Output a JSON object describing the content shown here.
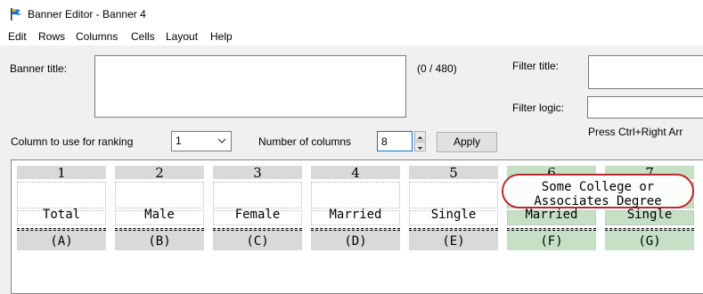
{
  "window": {
    "title": "Banner Editor - Banner 4"
  },
  "menu": [
    "Edit",
    "Rows",
    "Columns",
    "Cells",
    "Layout",
    "Help"
  ],
  "banner_title": {
    "label": "Banner title:",
    "value": "",
    "counter": "(0 / 480)"
  },
  "filter_title": {
    "label": "Filter title:",
    "value": ""
  },
  "filter_logic": {
    "label": "Filter logic:",
    "value": "",
    "hint": "Press Ctrl+Right Arr"
  },
  "ranking": {
    "label": "Column to use for ranking",
    "value": "1"
  },
  "num_columns": {
    "label": "Number of columns",
    "value": "8"
  },
  "apply_label": "Apply",
  "columns": [
    {
      "num": "1",
      "lines": [
        "",
        "",
        "Total"
      ],
      "letter": "(A)",
      "green": false
    },
    {
      "num": "2",
      "lines": [
        "",
        "",
        "Male"
      ],
      "letter": "(B)",
      "green": false
    },
    {
      "num": "3",
      "lines": [
        "",
        "",
        "Female"
      ],
      "letter": "(C)",
      "green": false
    },
    {
      "num": "4",
      "lines": [
        "",
        "",
        "Married"
      ],
      "letter": "(D)",
      "green": false
    },
    {
      "num": "5",
      "lines": [
        "",
        "",
        "Single"
      ],
      "letter": "(E)",
      "green": false
    },
    {
      "num": "6",
      "lines": [
        "",
        "",
        "Married"
      ],
      "letter": "(F)",
      "green": true
    },
    {
      "num": "7",
      "lines": [
        "",
        "",
        "Single"
      ],
      "letter": "(G)",
      "green": true
    }
  ],
  "highlight": {
    "line1": "Some College or",
    "line2": "Associates Degree"
  },
  "colors": {
    "accent": "#0078d7",
    "highlight_border": "#c0262f",
    "green_cell": "#c6e0c6",
    "gray_band": "#d9d9d9"
  }
}
